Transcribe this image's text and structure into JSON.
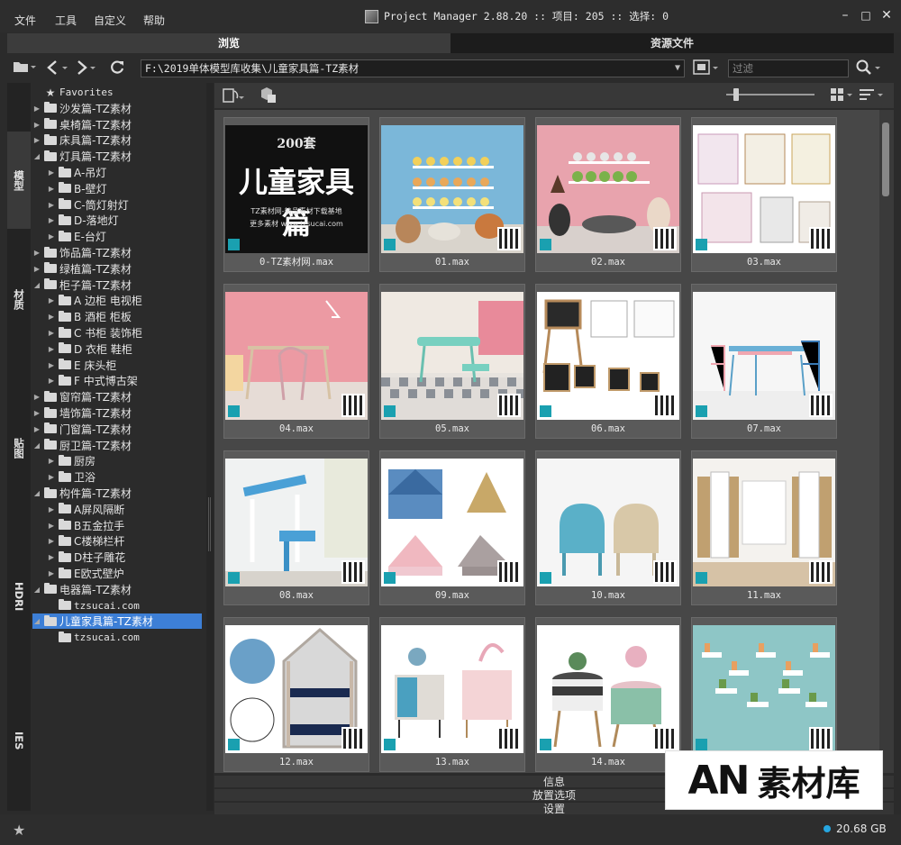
{
  "menubar": {
    "file": "文件",
    "tools": "工具",
    "custom": "自定义",
    "help": "帮助"
  },
  "title": "Project Manager 2.88.20  :: 项目: 205  :: 选择: 0",
  "tabs": {
    "browse": "浏览",
    "resources": "资源文件"
  },
  "toolbar": {
    "path": "F:\\2019单体模型库收集\\儿童家具篇-TZ素材",
    "filter_placeholder": "过滤"
  },
  "side_tabs": [
    "模型",
    "材质",
    "贴图",
    "HDRI",
    "IES"
  ],
  "tree": [
    {
      "label": "Favorites",
      "level": 0,
      "type": "star"
    },
    {
      "label": "沙发篇-TZ素材",
      "level": 0,
      "type": "folder",
      "arrow": "collapsed"
    },
    {
      "label": "桌椅篇-TZ素材",
      "level": 0,
      "type": "folder",
      "arrow": "collapsed"
    },
    {
      "label": "床具篇-TZ素材",
      "level": 0,
      "type": "folder",
      "arrow": "collapsed"
    },
    {
      "label": "灯具篇-TZ素材",
      "level": 0,
      "type": "folder",
      "arrow": "expanded"
    },
    {
      "label": "A-吊灯",
      "level": 1,
      "type": "folder",
      "arrow": "collapsed"
    },
    {
      "label": "B-壁灯",
      "level": 1,
      "type": "folder",
      "arrow": "collapsed"
    },
    {
      "label": "C-筒灯射灯",
      "level": 1,
      "type": "folder",
      "arrow": "collapsed"
    },
    {
      "label": "D-落地灯",
      "level": 1,
      "type": "folder",
      "arrow": "collapsed"
    },
    {
      "label": "E-台灯",
      "level": 1,
      "type": "folder",
      "arrow": "collapsed"
    },
    {
      "label": "饰品篇-TZ素材",
      "level": 0,
      "type": "folder",
      "arrow": "collapsed"
    },
    {
      "label": "绿植篇-TZ素材",
      "level": 0,
      "type": "folder",
      "arrow": "collapsed"
    },
    {
      "label": "柜子篇-TZ素材",
      "level": 0,
      "type": "folder",
      "arrow": "expanded"
    },
    {
      "label": "A 边柜 电视柜",
      "level": 1,
      "type": "folder",
      "arrow": "collapsed"
    },
    {
      "label": "B 酒柜 柜板",
      "level": 1,
      "type": "folder",
      "arrow": "collapsed"
    },
    {
      "label": "C 书柜 装饰柜",
      "level": 1,
      "type": "folder",
      "arrow": "collapsed"
    },
    {
      "label": "D 衣柜 鞋柜",
      "level": 1,
      "type": "folder",
      "arrow": "collapsed"
    },
    {
      "label": "E 床头柜",
      "level": 1,
      "type": "folder",
      "arrow": "collapsed"
    },
    {
      "label": "F 中式博古架",
      "level": 1,
      "type": "folder",
      "arrow": "collapsed"
    },
    {
      "label": "窗帘篇-TZ素材",
      "level": 0,
      "type": "folder",
      "arrow": "collapsed"
    },
    {
      "label": "墙饰篇-TZ素材",
      "level": 0,
      "type": "folder",
      "arrow": "collapsed"
    },
    {
      "label": "门窗篇-TZ素材",
      "level": 0,
      "type": "folder",
      "arrow": "collapsed"
    },
    {
      "label": "厨卫篇-TZ素材",
      "level": 0,
      "type": "folder",
      "arrow": "expanded"
    },
    {
      "label": "厨房",
      "level": 1,
      "type": "folder",
      "arrow": "collapsed"
    },
    {
      "label": "卫浴",
      "level": 1,
      "type": "folder",
      "arrow": "collapsed"
    },
    {
      "label": "构件篇-TZ素材",
      "level": 0,
      "type": "folder",
      "arrow": "expanded"
    },
    {
      "label": "A屏风隔断",
      "level": 1,
      "type": "folder",
      "arrow": "collapsed"
    },
    {
      "label": "B五金拉手",
      "level": 1,
      "type": "folder",
      "arrow": "collapsed"
    },
    {
      "label": "C楼梯栏杆",
      "level": 1,
      "type": "folder",
      "arrow": "collapsed"
    },
    {
      "label": "D柱子雕花",
      "level": 1,
      "type": "folder",
      "arrow": "collapsed"
    },
    {
      "label": "E欧式壁炉",
      "level": 1,
      "type": "folder",
      "arrow": "collapsed"
    },
    {
      "label": "电器篇-TZ素材",
      "level": 0,
      "type": "folder",
      "arrow": "expanded"
    },
    {
      "label": "tzsucai.com",
      "level": 1,
      "type": "folder",
      "arrow": "none"
    },
    {
      "label": "儿童家具篇-TZ素材",
      "level": 0,
      "type": "folder",
      "arrow": "expanded",
      "selected": true
    },
    {
      "label": "tzsucai.com",
      "level": 1,
      "type": "folder",
      "arrow": "none"
    }
  ],
  "cover": {
    "count": "200套",
    "title": "儿童家具篇",
    "line1": "TZ素材网-精品素材下载基地",
    "line2": "更多素材 www.tzsucai.com"
  },
  "items": [
    {
      "name": "0-TZ素材网.max",
      "theme": "cover"
    },
    {
      "name": "01.max",
      "theme": "blue"
    },
    {
      "name": "02.max",
      "theme": "pink"
    },
    {
      "name": "03.max",
      "theme": "white"
    },
    {
      "name": "04.max",
      "theme": "pink2"
    },
    {
      "name": "05.max",
      "theme": "room"
    },
    {
      "name": "06.max",
      "theme": "board"
    },
    {
      "name": "07.max",
      "theme": "white2"
    },
    {
      "name": "08.max",
      "theme": "desk"
    },
    {
      "name": "09.max",
      "theme": "tent"
    },
    {
      "name": "10.max",
      "theme": "chair"
    },
    {
      "name": "11.max",
      "theme": "wardrobe"
    },
    {
      "name": "12.max",
      "theme": "bunk"
    },
    {
      "name": "13.max",
      "theme": "cabinet"
    },
    {
      "name": "14.max",
      "theme": "stool"
    },
    {
      "name": "",
      "theme": "wall"
    }
  ],
  "accordion": {
    "info": "信息",
    "placement": "放置选项",
    "settings": "设置"
  },
  "status": {
    "disk": "20.68 GB"
  },
  "logo": {
    "an": "AN",
    "text": "素材库"
  },
  "colors": {
    "accent": "#3d7fd6",
    "max_badge": "#1aa0b0",
    "disk_dot": "#26a6e0"
  }
}
